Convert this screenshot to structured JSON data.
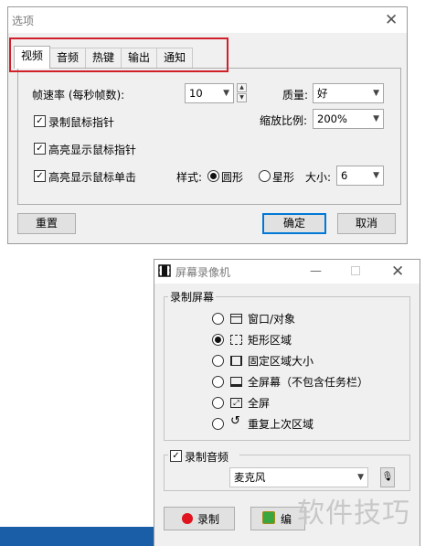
{
  "options_dialog": {
    "title": "选项",
    "tabs": [
      "视频",
      "音频",
      "热键",
      "输出",
      "通知"
    ],
    "active_tab": "视频",
    "frame_rate": {
      "label": "帧速率 (每秒帧数):",
      "value": "10"
    },
    "quality": {
      "label": "质量:",
      "value": "好"
    },
    "scale": {
      "label": "缩放比例:",
      "value": "200%"
    },
    "checkboxes": [
      {
        "label": "录制鼠标指针",
        "checked": true
      },
      {
        "label": "高亮显示鼠标指针",
        "checked": true
      },
      {
        "label": "高亮显示鼠标单击",
        "checked": true
      }
    ],
    "style": {
      "label": "样式:",
      "options": [
        "圆形",
        "星形"
      ],
      "selected": "圆形"
    },
    "size": {
      "label": "大小:",
      "value": "6"
    },
    "reset_label": "重置",
    "ok_label": "确定",
    "cancel_label": "取消"
  },
  "recorder": {
    "title": "屏幕录像机",
    "record_screen_group": "录制屏幕",
    "options": [
      {
        "label": "窗口/对象",
        "icon": "window-icon",
        "selected": false
      },
      {
        "label": "矩形区域",
        "icon": "dashed-rect-icon",
        "selected": true
      },
      {
        "label": "固定区域大小",
        "icon": "fixed-area-icon",
        "selected": false
      },
      {
        "label": "全屏幕（不包含任务栏）",
        "icon": "fullscreen-no-taskbar-icon",
        "selected": false
      },
      {
        "label": "全屏",
        "icon": "fullscreen-icon",
        "selected": false
      },
      {
        "label": "重复上次区域",
        "icon": "repeat-icon",
        "selected": false
      }
    ],
    "record_audio": {
      "label": "录制音频",
      "checked": true
    },
    "audio_source": "麦克风",
    "record_button": "录制",
    "edit_button": "编"
  },
  "watermark": "软件技巧",
  "colors": {
    "highlight_border": "#d0202a",
    "taskbar": "#1b5ea8",
    "default_button_border": "#0078d7",
    "record_dot": "#e0141e"
  }
}
